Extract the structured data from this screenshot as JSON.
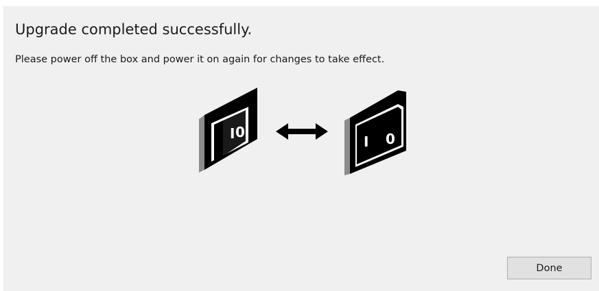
{
  "dialog": {
    "title": "Upgrade completed successfully.",
    "message": "Please power off the box and power it on again for changes to take effect.",
    "illustration": {
      "left_switch": {
        "state": "off",
        "labels": [
          "I",
          "0"
        ]
      },
      "right_switch": {
        "state": "on",
        "labels": [
          "I",
          "0"
        ]
      },
      "arrow_icon": "double-headed-arrow-icon"
    },
    "buttons": {
      "done_label": "Done"
    }
  },
  "colors": {
    "dialog_background": "#f0f0f0",
    "button_background": "#e1e1e1",
    "button_border": "#adadad",
    "switch_black": "#000000",
    "switch_gray": "#8c8c8c"
  }
}
